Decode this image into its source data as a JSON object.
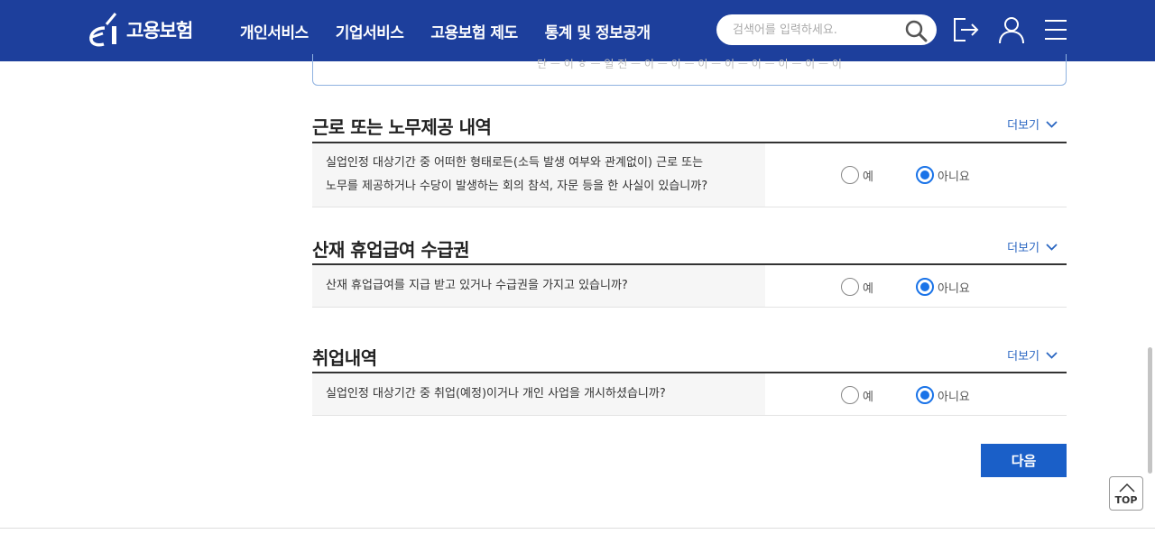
{
  "header": {
    "logo_text": "고용보험",
    "nav": [
      "개인서비스",
      "기업서비스",
      "고용보험 제도",
      "통계 및 정보공개"
    ],
    "search_placeholder": "검색어를 입력하세요.",
    "icons": [
      "search-icon",
      "logout-icon",
      "user-icon",
      "menu-icon"
    ],
    "brand_color": "#1d3f9c"
  },
  "topbox_text": "단 ㅡ 이 ㅎ ㅡ 일 전 ㅡ 이 ㅡ 이 ㅡ 이 ㅡ 이 ㅡ 이 ㅡ 이 ㅡ 이 ㅡ 이",
  "sections": [
    {
      "title": "근로 또는 노무제공 내역",
      "more": "더보기",
      "question_line1": "실업인정 대상기간 중 어떠한 형태로든(소득 발생 여부와 관계없이) 근로 또는",
      "question_line2": "노무를 제공하거나 수당이 발생하는 회의 참석, 자문 등을 한 사실이 있습니까?",
      "yes": "예",
      "no": "아니요",
      "selected": "no"
    },
    {
      "title": "산재 휴업급여 수급권",
      "more": "더보기",
      "question": "산재 휴업급여를 지급 받고 있거나 수급권을 가지고 있습니까?",
      "yes": "예",
      "no": "아니요",
      "selected": "no"
    },
    {
      "title": "취업내역",
      "more": "더보기",
      "question": "실업인정 대상기간 중 취업(예정)이거나 개인 사업을 개시하셨습니까?",
      "yes": "예",
      "no": "아니요",
      "selected": "no"
    }
  ],
  "next_button": "다음",
  "top_button": "TOP",
  "accent_color": "#1a73e8"
}
